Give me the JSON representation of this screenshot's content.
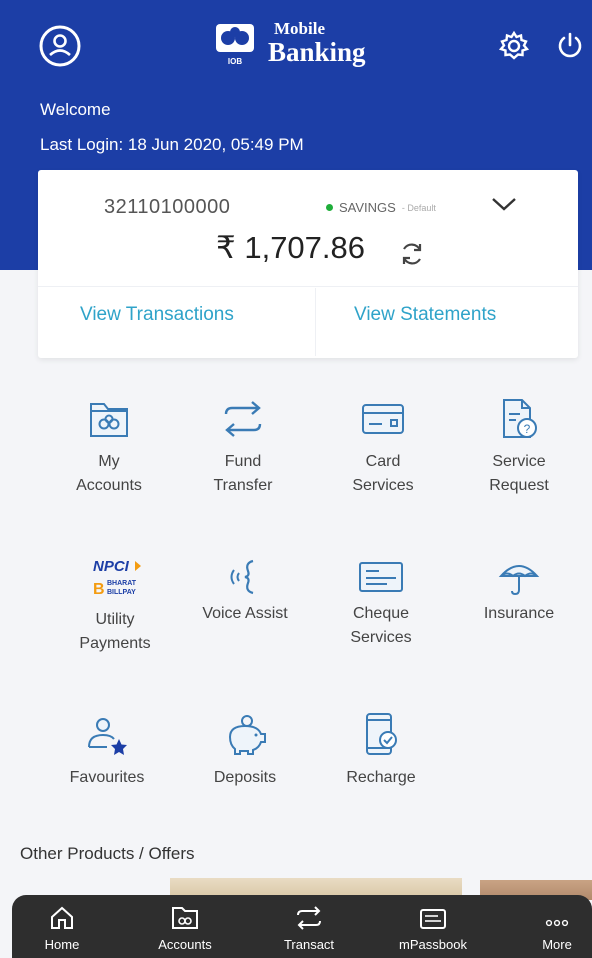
{
  "header": {
    "logo_line1": "Mobile",
    "logo_line2": "Banking",
    "logo_badge": "IOB",
    "welcome": "Welcome",
    "last_login": "Last Login: 18 Jun 2020, 05:49 PM"
  },
  "account": {
    "number": "32110100000",
    "type": "SAVINGS",
    "default_tag": "- Default",
    "balance": "₹ 1,707.86",
    "view_transactions": "View Transactions",
    "view_statements": "View Statements"
  },
  "services": [
    {
      "label": "My\nAccounts",
      "icon": "folder-icon"
    },
    {
      "label": "Fund\nTransfer",
      "icon": "transfer-arrows-icon"
    },
    {
      "label": "Card\nServices",
      "icon": "card-icon"
    },
    {
      "label": "Service\nRequest",
      "icon": "document-question-icon"
    },
    {
      "label": "Utility\nPayments",
      "icon": "npci-bharat-billpay-icon"
    },
    {
      "label": "Voice Assist",
      "icon": "voice-wave-icon"
    },
    {
      "label": "Cheque\nServices",
      "icon": "cheque-icon"
    },
    {
      "label": "Insurance",
      "icon": "umbrella-icon"
    },
    {
      "label": "Favourites",
      "icon": "user-star-icon"
    },
    {
      "label": "Deposits",
      "icon": "piggy-bank-icon"
    },
    {
      "label": "Recharge",
      "icon": "phone-recharge-icon"
    }
  ],
  "npci": {
    "line1": "NPCI",
    "b": "B",
    "line2": "BHARAT",
    "line3": "BILLPAY"
  },
  "offers_title": "Other Products / Offers",
  "bottom_nav": [
    {
      "label": "Home",
      "icon": "home-icon"
    },
    {
      "label": "Accounts",
      "icon": "accounts-icon"
    },
    {
      "label": "Transact",
      "icon": "transact-icon"
    },
    {
      "label": "mPassbook",
      "icon": "passbook-icon"
    },
    {
      "label": "More",
      "icon": "more-dots-icon"
    }
  ],
  "colors": {
    "header_blue": "#1c3ea6",
    "link_teal": "#2fa3c9",
    "icon_blue": "#3a7bb5",
    "nav_dark": "#2e2e2e"
  }
}
